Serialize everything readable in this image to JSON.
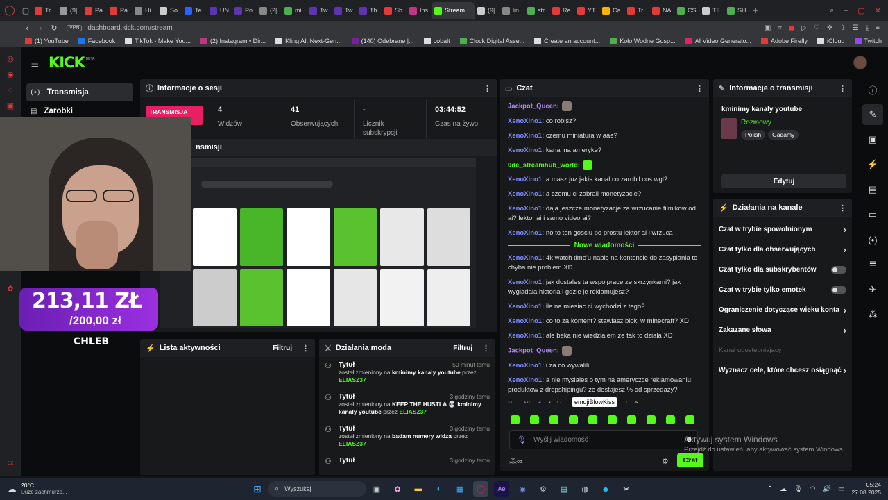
{
  "browser": {
    "tabs": [
      "Tr",
      "(9|",
      "Pa",
      "Pa",
      "Hi",
      "So",
      "Te",
      "UN",
      "Po",
      "(2|",
      "mi",
      "Tw",
      "Tw",
      "Th",
      "Sh",
      "Ins",
      "Stream",
      "(9|",
      "lin",
      "str",
      "Re",
      "YT",
      "Ca",
      "Tr",
      "NA",
      "CS",
      "TII",
      "SH"
    ],
    "tab_colors": [
      "#e53935",
      "#999",
      "#e53935",
      "#e53935",
      "#888",
      "#ccc",
      "#2962ff",
      "#5e35b1",
      "#5e35b1",
      "#888",
      "#4caf50",
      "#5e35b1",
      "#5e35b1",
      "#5e35b1",
      "#e53935",
      "#c13584",
      "#53fc18",
      "#ccc",
      "#888",
      "#4caf50",
      "#e53935",
      "#e53935",
      "#ffb300",
      "#e53935",
      "#e53935",
      "#4caf50",
      "#ccc",
      "#4caf50"
    ],
    "active_tab": "Stream",
    "url": "dashboard.kick.com/stream",
    "vpn": "VPN",
    "bookmarks": [
      "(1) YouTube",
      "Facebook",
      "TikTok - Make You...",
      "(2) Instagram • Dir...",
      "Kling AI: Next-Gen...",
      "(140) Odebrane |...",
      "cobalt",
      "Clock Digital Asse...",
      "Create an account...",
      "Koło Wodne Gosp...",
      "AI Video Generato...",
      "Adobe Firefly",
      "iCloud",
      "Twitch"
    ],
    "bookmark_colors": [
      "#e53935",
      "#1877f2",
      "#ddd",
      "#c13584",
      "#ddd",
      "#7b1fa2",
      "#ddd",
      "#4caf50",
      "#ddd",
      "#4caf50",
      "#e91e63",
      "#e53935",
      "#ddd",
      "#9146ff"
    ]
  },
  "kick": {
    "logo": "KICK",
    "beta": "BETA",
    "nav": {
      "stream": "Transmisja",
      "earnings": "Zarobki"
    },
    "session": {
      "title": "Informacje o sesji",
      "live_badge": "TRANSMISJA TRWA",
      "stats": [
        {
          "value": "4",
          "label": "Widzów"
        },
        {
          "value": "41",
          "label": "Obserwujących"
        },
        {
          "value": "-",
          "label": "Licznik subskrypcji"
        },
        {
          "value": "03:44:52",
          "label": "Czas na żywo"
        }
      ],
      "preview_title": "nsmisji"
    },
    "chat": {
      "title": "Czat",
      "messages": [
        {
          "user": "Jackpot_Queen:",
          "text": "",
          "color": "#b388ff"
        },
        {
          "user": "XenoXino1:",
          "text": "co robisz?"
        },
        {
          "user": "XenoXino1:",
          "text": "czemu miniatura w aae?"
        },
        {
          "user": "XenoXino1:",
          "text": "kanal na ameryke?"
        },
        {
          "user": "0de_streamhub_world:",
          "text": "",
          "color": "#53fc18"
        },
        {
          "user": "XenoXino1:",
          "text": "a masz juz jakis kanal co zarobil cos wgl?"
        },
        {
          "user": "XenoXino1:",
          "text": "a czemu ci zabrali monetyzacje?"
        },
        {
          "user": "XenoXino1:",
          "text": "daja jeszcze monetyzacje za wrzucanie filmikow od ai? lektor ai i samo video ai?"
        },
        {
          "user": "XenoXino1:",
          "text": "no to ten gosciu po prostu lektor ai i wrzuca"
        }
      ],
      "divider": "Nowe wiadomości",
      "new_messages": [
        {
          "user": "XenoXino1:",
          "text": "4k watch time'u nabic na kontencie do zasypiania to chyba nie problem XD"
        },
        {
          "user": "XenoXino1:",
          "text": "jak dostales ta wspolprace ze skrzynkami? jak wygladala historia i gdzie je reklamujesz?"
        },
        {
          "user": "XenoXino1:",
          "text": "ile na miesiac ci wychodzi z tego?"
        },
        {
          "user": "XenoXino1:",
          "text": "co to za kontent? stawiasz bloki w minecraft? XD"
        },
        {
          "user": "XenoXino1:",
          "text": "ale beka nie wiedzialem ze tak to dziala XD"
        },
        {
          "user": "Jackpot_Queen:",
          "text": "",
          "color": "#b388ff"
        },
        {
          "user": "XenoXino1:",
          "text": "i za co wywalili"
        },
        {
          "user": "XenoXino1:",
          "text": "a nie myslales o tym na ameryczce reklamowaniu produktow z dropshipingu? ze dostajesz % od sprzedazy?"
        },
        {
          "user": "XenoXino1:",
          "text": "chuj ten o"
        }
      ],
      "last_tail": "mies?",
      "tooltip": "emojiBlowKiss",
      "input_placeholder": "Wyślij wiadomość",
      "send_label": "Czat"
    },
    "stream_info": {
      "title": "Informacje o transmisji",
      "stream_title": "kminimy kanaly youtube",
      "category": "Rozmowy",
      "tags": [
        "Polish",
        "Gadamy"
      ],
      "edit_label": "Edytuj"
    },
    "channel_actions": {
      "title": "Działania na kanale",
      "items": [
        {
          "label": "Czat w trybie spowolnionym",
          "type": "arrow"
        },
        {
          "label": "Czat tylko dla obserwujących",
          "type": "arrow"
        },
        {
          "label": "Czat tylko dla subskrybentów",
          "type": "toggle"
        },
        {
          "label": "Czat w trybie tylko emotek",
          "type": "toggle"
        },
        {
          "label": "Ograniczenie dotyczące wieku konta",
          "type": "arrow"
        },
        {
          "label": "Zakazane słowa",
          "type": "arrow"
        },
        {
          "label": "Kanał udostępniający",
          "type": "disabled"
        },
        {
          "label": "Wyznacz cele, które chcesz osiągnąć",
          "type": "arrow"
        }
      ]
    },
    "activity": {
      "title": "Lista aktywności",
      "filter": "Filtruj"
    },
    "mod": {
      "title": "Działania moda",
      "filter": "Filtruj",
      "entries": [
        {
          "title": "Tytuł",
          "time": "50 minut temu",
          "pre": "został zmieniony na",
          "value": "kminimy kanaly youtube",
          "by": "przez",
          "user": "ELIASZ37"
        },
        {
          "title": "Tytuł",
          "time": "3 godziny temu",
          "pre": "został zmieniony na",
          "value": "KEEP THE HUSTLA 💀 kminimy kanaly youtube",
          "by": "przez",
          "user": "ELIASZ37"
        },
        {
          "title": "Tytuł",
          "time": "3 godziny temu",
          "pre": "został zmieniony na",
          "value": "badam numery widza",
          "by": "przez",
          "user": "ELIASZ37"
        },
        {
          "title": "Tytuł",
          "time": "3 godziny temu",
          "pre": "",
          "value": "",
          "by": "",
          "user": ""
        }
      ]
    },
    "overlay": {
      "amount": "213,11 ZŁ",
      "goal": "/200,00 zł",
      "name": "CHLEB"
    }
  },
  "windows": {
    "activate_title": "Aktywuj system Windows",
    "activate_sub": "Przejdź do ustawień, aby aktywować system Windows.",
    "weather_temp": "20°C",
    "weather_desc": "Duże zachmurze...",
    "search": "Wyszukaj",
    "time": "05:24",
    "date": "27.08.2025"
  },
  "colors": {
    "kick_green": "#53fc18",
    "live_red": "#e91e63",
    "chat_user": "#7d8cff"
  }
}
